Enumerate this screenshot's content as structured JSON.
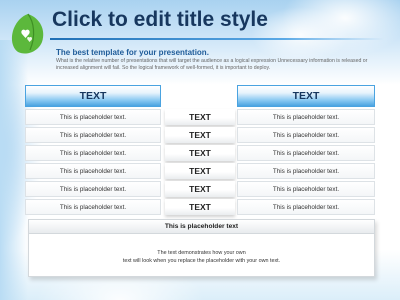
{
  "slide": {
    "title": "Click to edit title style",
    "subtitle": "The best template for your presentation.",
    "description": "What is the relative number of presentations that will target the audience as a logical expression Unnecessary information is released or increased alignment will fail. So the logical framework of well-formed, it is important to deploy.",
    "headers": {
      "left": "TEXT",
      "right": "TEXT"
    },
    "rows": [
      {
        "left": "This is placeholder text.",
        "middle": "TEXT",
        "right": "This is placeholder text."
      },
      {
        "left": "This is placeholder text.",
        "middle": "TEXT",
        "right": "This is placeholder text."
      },
      {
        "left": "This is placeholder text.",
        "middle": "TEXT",
        "right": "This is placeholder text."
      },
      {
        "left": "This is placeholder text.",
        "middle": "TEXT",
        "right": "This is placeholder text."
      },
      {
        "left": "This is placeholder text.",
        "middle": "TEXT",
        "right": "This is placeholder text."
      },
      {
        "left": "This is placeholder text.",
        "middle": "TEXT",
        "right": "This is placeholder text."
      }
    ],
    "bottom": {
      "title": "This is placeholder text",
      "line1": "The text demonstrates how your own",
      "line2": "text will look when you replace the placeholder with your own text."
    }
  },
  "colors": {
    "title": "#17375e",
    "accent": "#4aa3e0",
    "leaf": "#6cc04a"
  },
  "icons": {
    "logo": "leaf-heart-icon"
  }
}
